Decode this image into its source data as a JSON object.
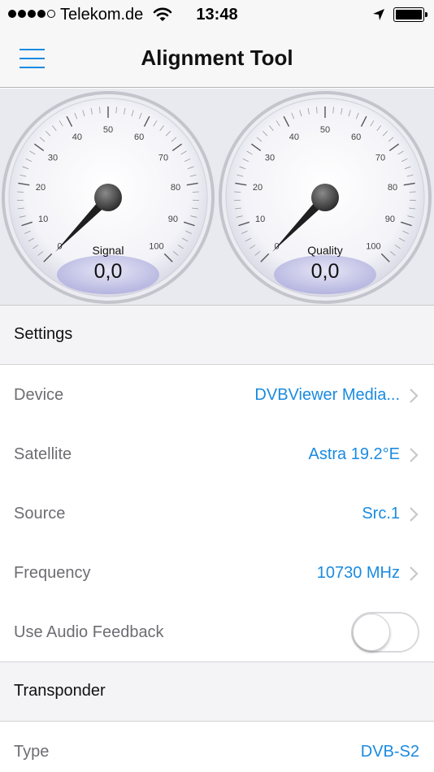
{
  "status_bar": {
    "carrier": "Telekom.de",
    "time": "13:48",
    "signal_dots_filled": 4,
    "signal_dots_total": 5,
    "battery_level": 1.0,
    "wifi_icon": "wifi-icon",
    "location_icon": "location-arrow-icon"
  },
  "nav": {
    "title": "Alignment Tool",
    "menu_icon": "hamburger-menu-icon"
  },
  "gauges": [
    {
      "label": "Signal",
      "value": "0,0",
      "ticks": [
        "0",
        "10",
        "20",
        "30",
        "40",
        "50",
        "60",
        "70",
        "80",
        "90",
        "100"
      ]
    },
    {
      "label": "Quality",
      "value": "0,0",
      "ticks": [
        "0",
        "10",
        "20",
        "30",
        "40",
        "50",
        "60",
        "70",
        "80",
        "90",
        "100"
      ]
    }
  ],
  "settings": {
    "header": "Settings",
    "rows": [
      {
        "label": "Device",
        "value": "DVBViewer Media..."
      },
      {
        "label": "Satellite",
        "value": "Astra 19.2°E"
      },
      {
        "label": "Source",
        "value": "Src.1"
      },
      {
        "label": "Frequency",
        "value": "10730 MHz"
      }
    ],
    "audio_feedback": {
      "label": "Use Audio Feedback",
      "enabled": false
    }
  },
  "transponder": {
    "header": "Transponder",
    "rows": [
      {
        "label": "Type",
        "value": "DVB-S2"
      }
    ]
  },
  "colors": {
    "accent": "#1a8be0",
    "secondary_text": "#6d6d72",
    "section_bg": "#f4f4f6"
  }
}
